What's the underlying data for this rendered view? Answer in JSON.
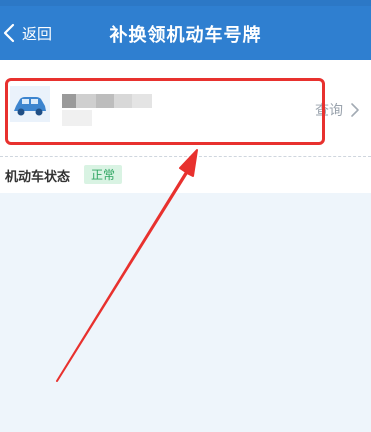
{
  "header": {
    "back_label": "返回",
    "title": "补换领机动车号牌"
  },
  "vehicle_card": {
    "icon": "car-icon",
    "plate_number": "",
    "query_label": "查询",
    "arrow_icon": "chevron-right-icon"
  },
  "status": {
    "label": "机动车状态",
    "value": "正常"
  },
  "colors": {
    "header": "#2f7fd0",
    "annotation": "#e8312e",
    "badge_bg": "#d9f3e3",
    "badge_text": "#2fa662"
  }
}
